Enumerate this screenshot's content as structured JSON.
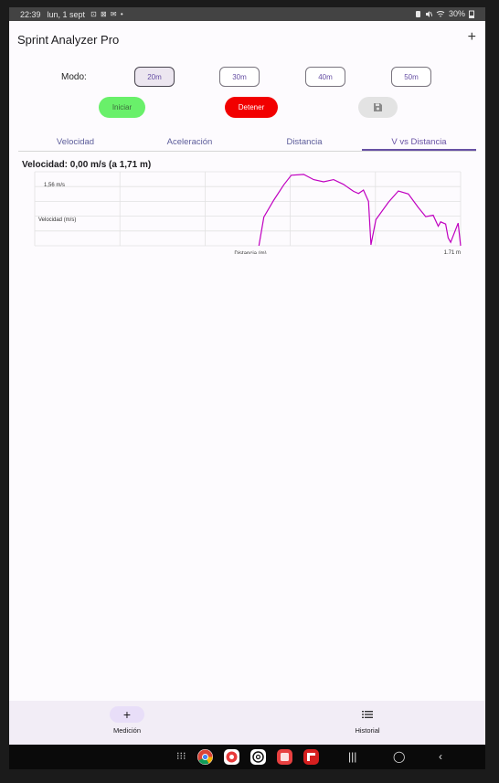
{
  "status": {
    "time": "22:39",
    "date": "lun, 1 sept",
    "indicators": "⊡ ⊠ ✉ •",
    "battery": "30%"
  },
  "app": {
    "title": "Sprint Analyzer Pro",
    "add_icon": "plus-icon"
  },
  "mode": {
    "label": "Modo:",
    "options": [
      "20m",
      "30m",
      "40m",
      "50m"
    ],
    "selected": "20m"
  },
  "actions": {
    "start": "Iniciar",
    "stop": "Detener",
    "save_icon": "save-icon"
  },
  "colors": {
    "start": "#69f06a",
    "stop": "#f20000",
    "accent": "#6750a4",
    "line": "#c000c0"
  },
  "tabs": [
    "Velocidad",
    "Aceleración",
    "Distancia",
    "V vs Distancia"
  ],
  "active_tab": "V vs Distancia",
  "readout": "Velocidad: 0,00 m/s (a 1,71 m)",
  "chart_data": {
    "type": "line",
    "ylabel": "Velocidad (m/s)",
    "xlabel": "Distancia (m)",
    "ytick": "1,56 m/s",
    "xtick": "1,71 m",
    "xlim": [
      0,
      1.71
    ],
    "ylim": [
      0,
      1.7
    ],
    "grid": true,
    "series": [
      {
        "values": [
          [
            0.9,
            0.0
          ],
          [
            0.92,
            0.66
          ],
          [
            0.96,
            1.05
          ],
          [
            1.0,
            1.4
          ],
          [
            1.03,
            1.62
          ],
          [
            1.08,
            1.64
          ],
          [
            1.12,
            1.52
          ],
          [
            1.16,
            1.47
          ],
          [
            1.2,
            1.52
          ],
          [
            1.24,
            1.41
          ],
          [
            1.28,
            1.25
          ],
          [
            1.3,
            1.2
          ],
          [
            1.32,
            1.28
          ],
          [
            1.34,
            1.02
          ],
          [
            1.35,
            0.02
          ],
          [
            1.37,
            0.6
          ],
          [
            1.42,
            1.0
          ],
          [
            1.46,
            1.26
          ],
          [
            1.5,
            1.19
          ],
          [
            1.54,
            0.88
          ],
          [
            1.57,
            0.67
          ],
          [
            1.6,
            0.7
          ],
          [
            1.62,
            0.45
          ],
          [
            1.63,
            0.55
          ],
          [
            1.65,
            0.5
          ],
          [
            1.66,
            0.18
          ],
          [
            1.67,
            0.08
          ],
          [
            1.7,
            0.52
          ],
          [
            1.71,
            0.0
          ]
        ]
      }
    ]
  },
  "nav": [
    {
      "label": "Medición",
      "icon": "plus-icon"
    },
    {
      "label": "Historial",
      "icon": "list-icon"
    }
  ]
}
